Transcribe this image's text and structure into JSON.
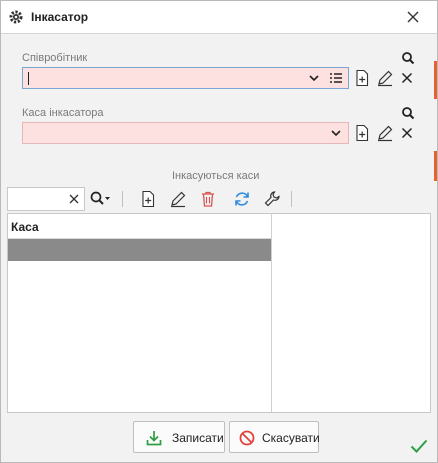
{
  "window": {
    "title": "Інкасатор"
  },
  "employee": {
    "label": "Співробітник",
    "value": ""
  },
  "cashbox": {
    "label": "Каса інкасатора",
    "value": ""
  },
  "cashboxes_section": {
    "title": "Інкасуються каси"
  },
  "grid": {
    "columns": [
      "Каса"
    ],
    "rows": [
      ""
    ]
  },
  "buttons": {
    "save": "Записати",
    "cancel": "Скасувати"
  },
  "colors": {
    "required_field": "#fde0e0",
    "selected_row": "#8a8a8a",
    "accent": "#e8632b"
  }
}
